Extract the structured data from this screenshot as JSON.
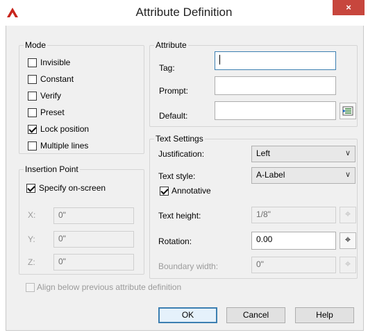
{
  "window": {
    "title": "Attribute Definition",
    "close_label": "×"
  },
  "mode": {
    "label": "Mode",
    "items": [
      {
        "label": "Invisible",
        "checked": false
      },
      {
        "label": "Constant",
        "checked": false
      },
      {
        "label": "Verify",
        "checked": false
      },
      {
        "label": "Preset",
        "checked": false
      },
      {
        "label": "Lock position",
        "checked": true
      },
      {
        "label": "Multiple lines",
        "checked": false
      }
    ]
  },
  "insertion": {
    "label": "Insertion Point",
    "specify_label": "Specify on-screen",
    "specify_checked": true,
    "x_label": "X:",
    "x_value": "0\"",
    "y_label": "Y:",
    "y_value": "0\"",
    "z_label": "Z:",
    "z_value": "0\""
  },
  "attribute": {
    "label": "Attribute",
    "tag_label": "Tag:",
    "tag_value": "",
    "prompt_label": "Prompt:",
    "prompt_value": "",
    "default_label": "Default:",
    "default_value": ""
  },
  "text_settings": {
    "label": "Text Settings",
    "justification_label": "Justification:",
    "justification_value": "Left",
    "style_label": "Text style:",
    "style_value": "A-Label",
    "annotative_label": "Annotative",
    "annotative_checked": true,
    "height_label": "Text height:",
    "height_value": "1/8\"",
    "rotation_label": "Rotation:",
    "rotation_value": "0.00",
    "boundary_label": "Boundary width:",
    "boundary_value": "0\""
  },
  "align_label": "Align below previous attribute definition",
  "buttons": {
    "ok": "OK",
    "cancel": "Cancel",
    "help": "Help"
  },
  "colors": {
    "close_bg": "#c7463d",
    "focus_border": "#3c7fb1",
    "icon_red": "#c8251c"
  }
}
